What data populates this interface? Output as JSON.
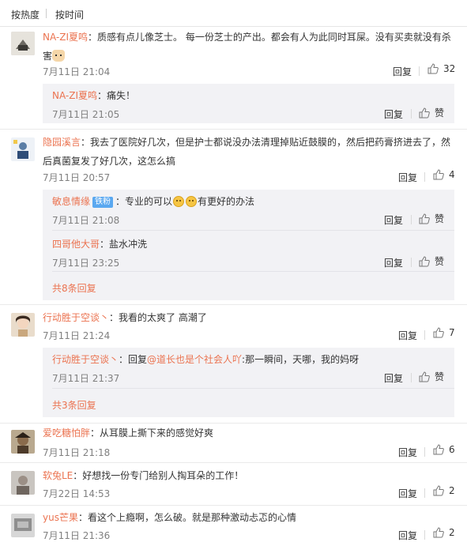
{
  "sort": {
    "hot": "按热度",
    "time": "按时间"
  },
  "labels": {
    "reply": "回复",
    "like": "赞"
  },
  "colors": {
    "username": "#eb7350",
    "reply_bg": "#f2f2f5",
    "badge": "#5aa8f0"
  },
  "comments": [
    {
      "user": "NA-ZI夏鸣",
      "text": "：质感有点儿像芝士。 每一份芝士的产出。都会有人为此同时耳屎。没有买卖就没有杀",
      "text2": "害",
      "time": "7月11日 21:04",
      "likes": "32",
      "replies": [
        {
          "user": "NA-ZI夏鸣",
          "text": "：痛失！",
          "time": "7月11日 21:05"
        }
      ]
    },
    {
      "user": "隐园溪言",
      "text": "：我去了医院好几次，但是护士都说没办法清理掉贴近鼓膜的，然后把药膏挤进去了，然",
      "text2": "后真菌复发了好几次，这怎么搞",
      "time": "7月11日 20:57",
      "likes": "4",
      "replies": [
        {
          "user": "敏息情缘",
          "badge": "铁粉",
          "text": "：专业的可以",
          "text_b": "有更好的办法",
          "time": "7月11日 21:08"
        },
        {
          "user": "四哥他大哥",
          "text": "：盐水冲洗",
          "time": "7月11日 23:25"
        }
      ],
      "more": "共8条回复"
    },
    {
      "user": "行动胜于空谈丶",
      "text": "：我看的太爽了  高潮了",
      "time": "7月11日 21:24",
      "likes": "7",
      "replies": [
        {
          "user": "行动胜于空谈丶",
          "text_pre": "：回复",
          "mention": "@道长也是个社会人吖",
          "text": ":那一瞬间，天哪，我的妈呀",
          "time": "7月11日 21:37"
        }
      ],
      "more": "共3条回复"
    },
    {
      "user": "爱吃糖怕胖",
      "text": "：从耳膜上撕下来的感觉好爽",
      "time": "7月11日 21:18",
      "likes": "6"
    },
    {
      "user": "软兔LE",
      "text": "：好想找一份专门给别人掏耳朵的工作！",
      "time": "7月22日 14:53",
      "likes": "2"
    },
    {
      "user": "yus芒果",
      "text": "：看这个上瘾啊，怎么破。就是那种激动忐忑的心情",
      "time": "7月11日 21:36",
      "likes": "2"
    }
  ]
}
